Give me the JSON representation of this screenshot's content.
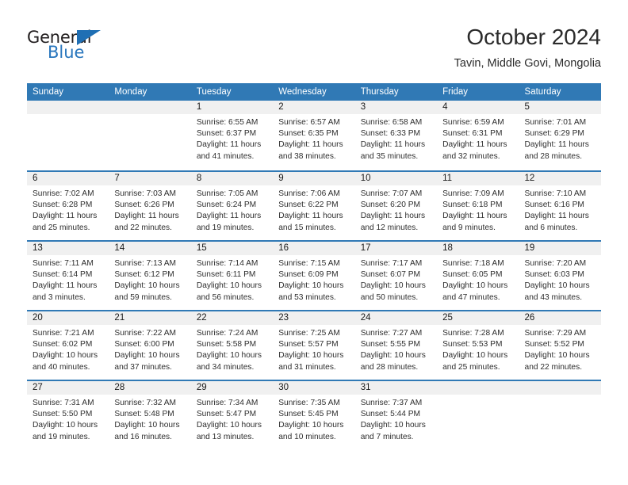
{
  "logo": {
    "word_one": "General",
    "word_two": "Blue",
    "triangle_icon": "triangle-icon",
    "brand_blue": "#2876bd",
    "brand_dark": "#231f20"
  },
  "header": {
    "title": "October 2024",
    "subtitle": "Tavin, Middle Govi, Mongolia"
  },
  "calendar": {
    "header_color": "#3079b5",
    "day_band_color": "#f0f0f0",
    "weekdays": [
      "Sunday",
      "Monday",
      "Tuesday",
      "Wednesday",
      "Thursday",
      "Friday",
      "Saturday"
    ],
    "weeks": [
      [
        {
          "day": "",
          "sunrise": "",
          "sunset": "",
          "daylight": "",
          "empty": true
        },
        {
          "day": "",
          "sunrise": "",
          "sunset": "",
          "daylight": "",
          "empty": true
        },
        {
          "day": "1",
          "sunrise": "Sunrise: 6:55 AM",
          "sunset": "Sunset: 6:37 PM",
          "daylight": "Daylight: 11 hours and 41 minutes."
        },
        {
          "day": "2",
          "sunrise": "Sunrise: 6:57 AM",
          "sunset": "Sunset: 6:35 PM",
          "daylight": "Daylight: 11 hours and 38 minutes."
        },
        {
          "day": "3",
          "sunrise": "Sunrise: 6:58 AM",
          "sunset": "Sunset: 6:33 PM",
          "daylight": "Daylight: 11 hours and 35 minutes."
        },
        {
          "day": "4",
          "sunrise": "Sunrise: 6:59 AM",
          "sunset": "Sunset: 6:31 PM",
          "daylight": "Daylight: 11 hours and 32 minutes."
        },
        {
          "day": "5",
          "sunrise": "Sunrise: 7:01 AM",
          "sunset": "Sunset: 6:29 PM",
          "daylight": "Daylight: 11 hours and 28 minutes."
        }
      ],
      [
        {
          "day": "6",
          "sunrise": "Sunrise: 7:02 AM",
          "sunset": "Sunset: 6:28 PM",
          "daylight": "Daylight: 11 hours and 25 minutes."
        },
        {
          "day": "7",
          "sunrise": "Sunrise: 7:03 AM",
          "sunset": "Sunset: 6:26 PM",
          "daylight": "Daylight: 11 hours and 22 minutes."
        },
        {
          "day": "8",
          "sunrise": "Sunrise: 7:05 AM",
          "sunset": "Sunset: 6:24 PM",
          "daylight": "Daylight: 11 hours and 19 minutes."
        },
        {
          "day": "9",
          "sunrise": "Sunrise: 7:06 AM",
          "sunset": "Sunset: 6:22 PM",
          "daylight": "Daylight: 11 hours and 15 minutes."
        },
        {
          "day": "10",
          "sunrise": "Sunrise: 7:07 AM",
          "sunset": "Sunset: 6:20 PM",
          "daylight": "Daylight: 11 hours and 12 minutes."
        },
        {
          "day": "11",
          "sunrise": "Sunrise: 7:09 AM",
          "sunset": "Sunset: 6:18 PM",
          "daylight": "Daylight: 11 hours and 9 minutes."
        },
        {
          "day": "12",
          "sunrise": "Sunrise: 7:10 AM",
          "sunset": "Sunset: 6:16 PM",
          "daylight": "Daylight: 11 hours and 6 minutes."
        }
      ],
      [
        {
          "day": "13",
          "sunrise": "Sunrise: 7:11 AM",
          "sunset": "Sunset: 6:14 PM",
          "daylight": "Daylight: 11 hours and 3 minutes."
        },
        {
          "day": "14",
          "sunrise": "Sunrise: 7:13 AM",
          "sunset": "Sunset: 6:12 PM",
          "daylight": "Daylight: 10 hours and 59 minutes."
        },
        {
          "day": "15",
          "sunrise": "Sunrise: 7:14 AM",
          "sunset": "Sunset: 6:11 PM",
          "daylight": "Daylight: 10 hours and 56 minutes."
        },
        {
          "day": "16",
          "sunrise": "Sunrise: 7:15 AM",
          "sunset": "Sunset: 6:09 PM",
          "daylight": "Daylight: 10 hours and 53 minutes."
        },
        {
          "day": "17",
          "sunrise": "Sunrise: 7:17 AM",
          "sunset": "Sunset: 6:07 PM",
          "daylight": "Daylight: 10 hours and 50 minutes."
        },
        {
          "day": "18",
          "sunrise": "Sunrise: 7:18 AM",
          "sunset": "Sunset: 6:05 PM",
          "daylight": "Daylight: 10 hours and 47 minutes."
        },
        {
          "day": "19",
          "sunrise": "Sunrise: 7:20 AM",
          "sunset": "Sunset: 6:03 PM",
          "daylight": "Daylight: 10 hours and 43 minutes."
        }
      ],
      [
        {
          "day": "20",
          "sunrise": "Sunrise: 7:21 AM",
          "sunset": "Sunset: 6:02 PM",
          "daylight": "Daylight: 10 hours and 40 minutes."
        },
        {
          "day": "21",
          "sunrise": "Sunrise: 7:22 AM",
          "sunset": "Sunset: 6:00 PM",
          "daylight": "Daylight: 10 hours and 37 minutes."
        },
        {
          "day": "22",
          "sunrise": "Sunrise: 7:24 AM",
          "sunset": "Sunset: 5:58 PM",
          "daylight": "Daylight: 10 hours and 34 minutes."
        },
        {
          "day": "23",
          "sunrise": "Sunrise: 7:25 AM",
          "sunset": "Sunset: 5:57 PM",
          "daylight": "Daylight: 10 hours and 31 minutes."
        },
        {
          "day": "24",
          "sunrise": "Sunrise: 7:27 AM",
          "sunset": "Sunset: 5:55 PM",
          "daylight": "Daylight: 10 hours and 28 minutes."
        },
        {
          "day": "25",
          "sunrise": "Sunrise: 7:28 AM",
          "sunset": "Sunset: 5:53 PM",
          "daylight": "Daylight: 10 hours and 25 minutes."
        },
        {
          "day": "26",
          "sunrise": "Sunrise: 7:29 AM",
          "sunset": "Sunset: 5:52 PM",
          "daylight": "Daylight: 10 hours and 22 minutes."
        }
      ],
      [
        {
          "day": "27",
          "sunrise": "Sunrise: 7:31 AM",
          "sunset": "Sunset: 5:50 PM",
          "daylight": "Daylight: 10 hours and 19 minutes."
        },
        {
          "day": "28",
          "sunrise": "Sunrise: 7:32 AM",
          "sunset": "Sunset: 5:48 PM",
          "daylight": "Daylight: 10 hours and 16 minutes."
        },
        {
          "day": "29",
          "sunrise": "Sunrise: 7:34 AM",
          "sunset": "Sunset: 5:47 PM",
          "daylight": "Daylight: 10 hours and 13 minutes."
        },
        {
          "day": "30",
          "sunrise": "Sunrise: 7:35 AM",
          "sunset": "Sunset: 5:45 PM",
          "daylight": "Daylight: 10 hours and 10 minutes."
        },
        {
          "day": "31",
          "sunrise": "Sunrise: 7:37 AM",
          "sunset": "Sunset: 5:44 PM",
          "daylight": "Daylight: 10 hours and 7 minutes."
        },
        {
          "day": "",
          "sunrise": "",
          "sunset": "",
          "daylight": "",
          "empty": true
        },
        {
          "day": "",
          "sunrise": "",
          "sunset": "",
          "daylight": "",
          "empty": true
        }
      ]
    ]
  }
}
